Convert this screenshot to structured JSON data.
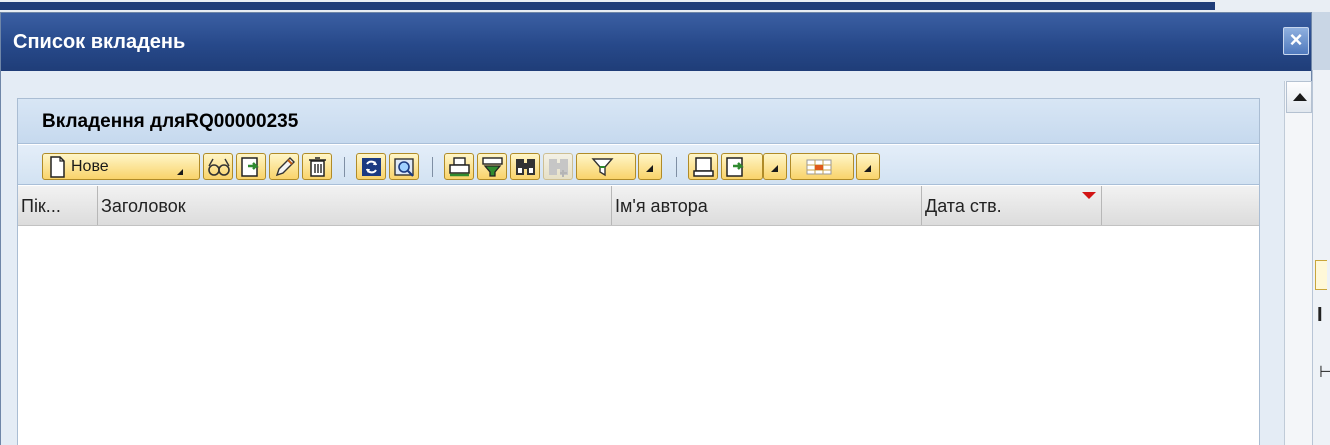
{
  "dialog": {
    "title": "Список вкладень",
    "close_label": "×"
  },
  "panel": {
    "heading": "Вкладення дляRQ00000235"
  },
  "toolbar": {
    "new_label": "Нове",
    "buttons": [
      {
        "name": "new-icon"
      },
      {
        "name": "glasses-icon"
      },
      {
        "name": "export-icon"
      },
      {
        "name": "pencil-icon"
      },
      {
        "name": "trash-icon"
      },
      {
        "name": "refresh-icon"
      },
      {
        "name": "details-icon"
      },
      {
        "name": "print-icon"
      },
      {
        "name": "sort-icon"
      },
      {
        "name": "find-icon"
      },
      {
        "name": "find-next-icon"
      },
      {
        "name": "filter-icon"
      },
      {
        "name": "print-preview-icon"
      },
      {
        "name": "export-list-icon"
      },
      {
        "name": "layout-icon"
      }
    ]
  },
  "grid": {
    "columns": [
      "Пік...",
      "Заголовок",
      "Ім'я автора",
      "Дата ств."
    ],
    "sort_color": "#d21414",
    "rows": []
  },
  "colors": {
    "titlebar": "#27498a",
    "button_fill": "#f9d36a",
    "panel_header": "#c6d9ee"
  }
}
